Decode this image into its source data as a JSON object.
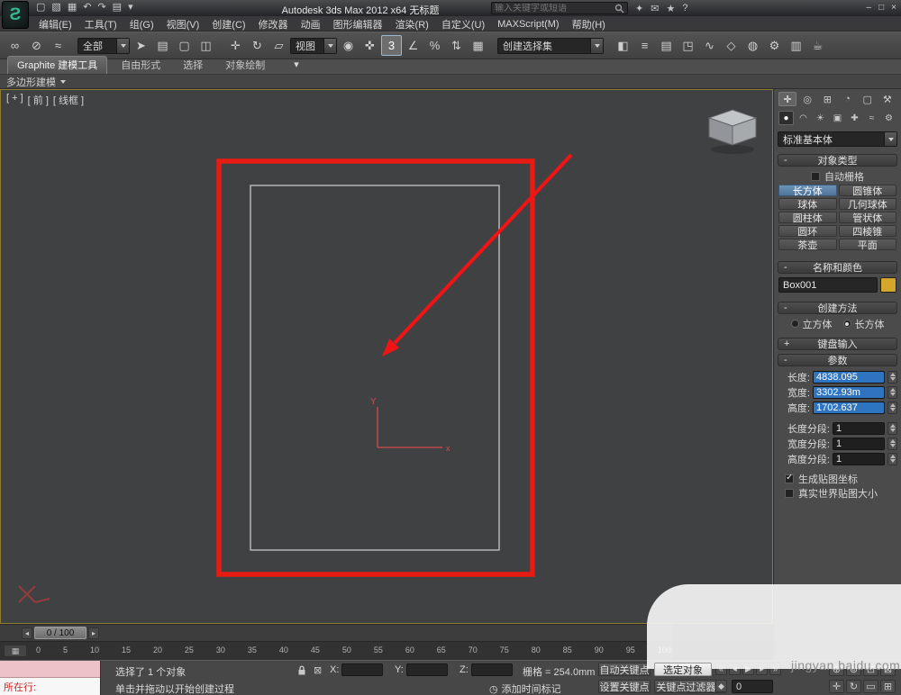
{
  "window": {
    "logo_glyph": "Ƨ",
    "title": "Autodesk 3ds Max  2012 x64   无标题",
    "search_placeholder": "输入关键字或短语",
    "qat_icons": [
      {
        "name": "new-scene-icon",
        "glyph": "▢"
      },
      {
        "name": "open-file-icon",
        "glyph": "▧"
      },
      {
        "name": "save-file-icon",
        "glyph": "▦"
      },
      {
        "name": "undo-icon",
        "glyph": "↶"
      },
      {
        "name": "redo-icon",
        "glyph": "↷"
      },
      {
        "name": "project-folder-icon",
        "glyph": "▤"
      },
      {
        "name": "qat-dropdown-icon",
        "glyph": "▾"
      }
    ],
    "infocenter_icons": [
      {
        "name": "subscription-icon",
        "glyph": "✦"
      },
      {
        "name": "communication-center-icon",
        "glyph": "✉"
      },
      {
        "name": "favorites-icon",
        "glyph": "★"
      },
      {
        "name": "help-icon",
        "glyph": "?"
      }
    ],
    "window_controls": [
      {
        "name": "minimize-button",
        "glyph": "–"
      },
      {
        "name": "maximize-button",
        "glyph": "□"
      },
      {
        "name": "close-button",
        "glyph": "×"
      }
    ]
  },
  "menus": [
    {
      "label": "编辑(E)"
    },
    {
      "label": "工具(T)"
    },
    {
      "label": "组(G)"
    },
    {
      "label": "视图(V)"
    },
    {
      "label": "创建(C)"
    },
    {
      "label": "修改器"
    },
    {
      "label": "动画"
    },
    {
      "label": "图形编辑器"
    },
    {
      "label": "渲染(R)"
    },
    {
      "label": "自定义(U)"
    },
    {
      "label": "MAXScript(M)"
    },
    {
      "label": "帮助(H)"
    }
  ],
  "toolbar": {
    "group1": [
      {
        "name": "select-and-link-icon",
        "glyph": "∞"
      },
      {
        "name": "unlink-selection-icon",
        "glyph": "⊘"
      },
      {
        "name": "bind-to-space-warp-icon",
        "glyph": "≈"
      }
    ],
    "filter_dropdown": {
      "value": "全部"
    },
    "group2": [
      {
        "name": "select-object-icon",
        "glyph": "➤"
      },
      {
        "name": "select-by-name-icon",
        "glyph": "▤"
      },
      {
        "name": "selection-region-icon",
        "glyph": "▢"
      },
      {
        "name": "window-crossing-icon",
        "glyph": "◫"
      }
    ],
    "group3": [
      {
        "name": "select-move-icon",
        "glyph": "✛"
      },
      {
        "name": "select-rotate-icon",
        "glyph": "↻"
      },
      {
        "name": "select-scale-icon",
        "glyph": "▱"
      }
    ],
    "coord_dropdown": {
      "value": "视图"
    },
    "group4": [
      {
        "name": "use-pivot-center-icon",
        "glyph": "◉"
      },
      {
        "name": "select-manipulate-icon",
        "glyph": "✜"
      },
      {
        "name": "snap-toggle-3d-icon",
        "glyph": "3",
        "active": true
      },
      {
        "name": "angle-snap-icon",
        "glyph": "∠"
      },
      {
        "name": "percent-snap-icon",
        "glyph": "%"
      },
      {
        "name": "spinner-snap-icon",
        "glyph": "⇅"
      },
      {
        "name": "named-selection-sets-icon",
        "glyph": "▦"
      }
    ],
    "sets_dropdown": {
      "value": "创建选择集"
    },
    "group5": [
      {
        "name": "mirror-icon",
        "glyph": "◧"
      },
      {
        "name": "align-icon",
        "glyph": "≡"
      },
      {
        "name": "layer-manager-icon",
        "glyph": "▤"
      },
      {
        "name": "graphite-ribbon-icon",
        "glyph": "◳"
      },
      {
        "name": "curve-editor-icon",
        "glyph": "∿"
      },
      {
        "name": "schematic-view-icon",
        "glyph": "◇"
      },
      {
        "name": "material-editor-icon",
        "glyph": "◍"
      },
      {
        "name": "render-setup-icon",
        "glyph": "⚙"
      },
      {
        "name": "rendered-frame-icon",
        "glyph": "▥"
      },
      {
        "name": "render-production-icon",
        "glyph": "☕"
      }
    ]
  },
  "ribbon": {
    "tabs": [
      {
        "label": "Graphite 建模工具",
        "active": true
      },
      {
        "label": "自由形式"
      },
      {
        "label": "选择"
      },
      {
        "label": "对象绘制"
      }
    ],
    "dropdown_glyph": "▾",
    "collapsed_panel": "多边形建模"
  },
  "viewport": {
    "labels": [
      "[ + ]",
      "[ 前 ]",
      "[ 线框 ]"
    ],
    "gizmo_y": "Y",
    "gizmo_x": "x"
  },
  "command_panel": {
    "tabs": [
      {
        "name": "create-tab",
        "glyph": "✛",
        "active": true
      },
      {
        "name": "modify-tab",
        "glyph": "◎"
      },
      {
        "name": "hierarchy-tab",
        "glyph": "⊞"
      },
      {
        "name": "motion-tab",
        "glyph": "◔"
      },
      {
        "name": "display-tab",
        "glyph": "▢"
      },
      {
        "name": "utilities-tab",
        "glyph": "⚒"
      }
    ],
    "categories": [
      {
        "name": "geometry-category",
        "glyph": "●",
        "active": true
      },
      {
        "name": "shapes-category",
        "glyph": "◠"
      },
      {
        "name": "lights-category",
        "glyph": "☀"
      },
      {
        "name": "cameras-category",
        "glyph": "▣"
      },
      {
        "name": "helpers-category",
        "glyph": "✚"
      },
      {
        "name": "space-warps-category",
        "glyph": "≈"
      },
      {
        "name": "systems-category",
        "glyph": "⚙"
      }
    ],
    "subcategory_dropdown": "标准基本体",
    "object_type": {
      "title": "对象类型",
      "collapse": "-",
      "autogrid_label": "自动栅格",
      "autogrid_checked": false,
      "buttons": [
        {
          "label": "长方体",
          "active": true
        },
        {
          "label": "圆锥体"
        },
        {
          "label": "球体"
        },
        {
          "label": "几何球体"
        },
        {
          "label": "圆柱体"
        },
        {
          "label": "管状体"
        },
        {
          "label": "圆环"
        },
        {
          "label": "四棱锥"
        },
        {
          "label": "茶壶"
        },
        {
          "label": "平面"
        }
      ]
    },
    "name_color": {
      "title": "名称和颜色",
      "collapse": "-",
      "object_name": "Box001",
      "swatch_color": "#d4a72c"
    },
    "creation_method": {
      "title": "创建方法",
      "collapse": "-",
      "options": [
        {
          "label": "立方体",
          "selected": false
        },
        {
          "label": "长方体",
          "selected": true
        }
      ]
    },
    "keyboard_entry": {
      "title": "键盘输入",
      "collapse": "+"
    },
    "parameters": {
      "title": "参数",
      "collapse": "-",
      "dims": [
        {
          "label": "长度:",
          "value": "4838.095",
          "hl": true
        },
        {
          "label": "宽度:",
          "value": "3302.93m",
          "hl": true
        },
        {
          "label": "高度:",
          "value": "1702.637",
          "hl": true
        }
      ],
      "segs": [
        {
          "label": "长度分段:",
          "value": "1"
        },
        {
          "label": "宽度分段:",
          "value": "1"
        },
        {
          "label": "高度分段:",
          "value": "1"
        }
      ],
      "checks": [
        {
          "label": "生成贴图坐标",
          "checked": true
        },
        {
          "label": "真实世界贴图大小",
          "checked": false
        }
      ]
    }
  },
  "timeline": {
    "handle": "0 / 100",
    "left_arrow": "◂",
    "right_arrow": "▸",
    "ruler_button_glyph": "▦",
    "ticks": [
      "0",
      "5",
      "10",
      "15",
      "20",
      "25",
      "30",
      "35",
      "40",
      "45",
      "50",
      "55",
      "60",
      "65",
      "70",
      "75",
      "80",
      "85",
      "90",
      "95",
      "100"
    ]
  },
  "status": {
    "listener_prompt": "所在行:",
    "selection": "选择了 1 个对象",
    "prompt": "单击并拖动以开始创建过程",
    "abs_icon": "⊠",
    "x_label": "X:",
    "y_label": "Y:",
    "z_label": "Z:",
    "grid": "栅格 = 254.0mm",
    "timetag_icon": "◷",
    "time_tag": "添加时间标记",
    "auto_key": "自动关键点",
    "set_key": "设置关键点",
    "selected_filter": "选定对象",
    "key_filters": "关键点过滤器...",
    "keymode_icon": "◆",
    "frame_field": "0",
    "playback": [
      {
        "name": "go-to-start-icon",
        "glyph": "«"
      },
      {
        "name": "previous-frame-icon",
        "glyph": "◂"
      },
      {
        "name": "play-button-icon",
        "glyph": "▶"
      },
      {
        "name": "next-frame-icon",
        "glyph": "▸"
      },
      {
        "name": "go-to-end-icon",
        "glyph": "»"
      }
    ],
    "nav_row1": [
      {
        "name": "zoom-icon",
        "glyph": "⊕"
      },
      {
        "name": "zoom-all-icon",
        "glyph": "⊚"
      },
      {
        "name": "zoom-extents-icon",
        "glyph": "⊡"
      },
      {
        "name": "zoom-extents-all-icon",
        "glyph": "⊠"
      }
    ],
    "nav_row2": [
      {
        "name": "pan-icon",
        "glyph": "✛"
      },
      {
        "name": "orbit-icon",
        "glyph": "↻"
      },
      {
        "name": "region-zoom-icon",
        "glyph": "▭"
      },
      {
        "name": "maximize-viewport-icon",
        "glyph": "⊞"
      }
    ]
  },
  "watermark": {
    "text": "jingyan.baidu.com"
  }
}
